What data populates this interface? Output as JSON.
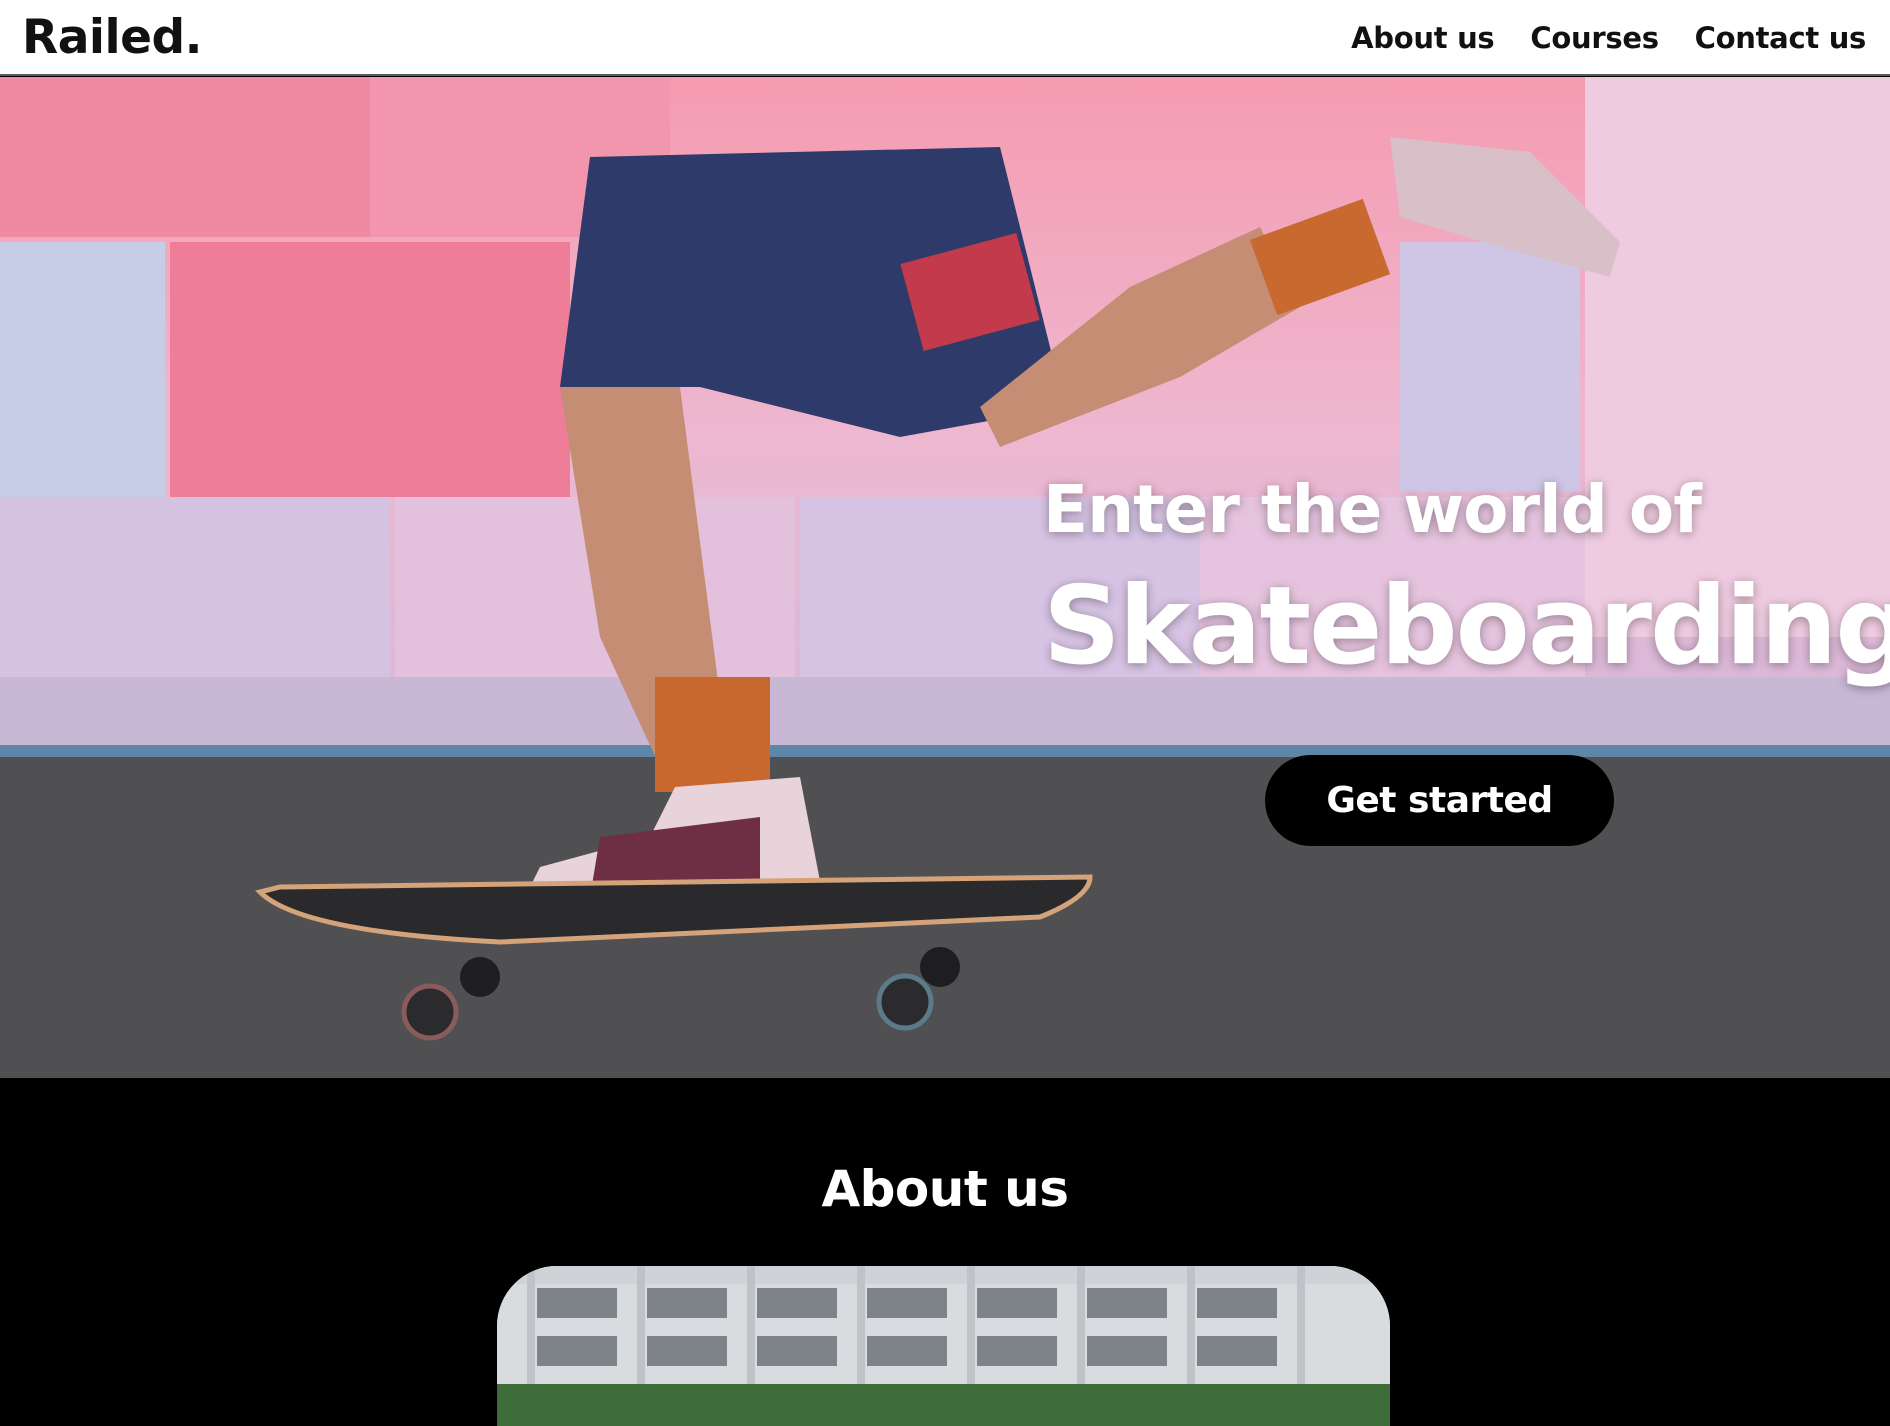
{
  "brand": {
    "logo": "Railed."
  },
  "nav": {
    "items": [
      "About us",
      "Courses",
      "Contact us"
    ]
  },
  "hero": {
    "title_line1": "Enter the world of",
    "title_line2": "Skateboarding",
    "cta_label": "Get started",
    "image_alt": "skateboarder-photo"
  },
  "about": {
    "title": "About us",
    "image_alt": "building-photo"
  },
  "colors": {
    "header_bg": "#ffffff",
    "page_bg": "#000000",
    "button_bg": "#000000",
    "text_light": "#ffffff"
  }
}
